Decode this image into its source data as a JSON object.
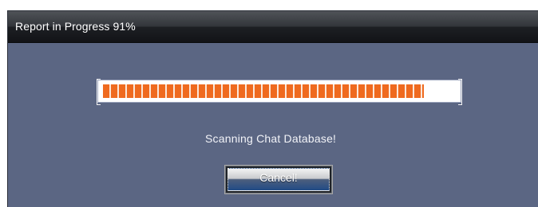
{
  "window": {
    "title": "Report in Progress 91%"
  },
  "progress": {
    "value": 0.91,
    "accent": "#ef6a1f"
  },
  "status": {
    "text": "Scanning Chat Database!"
  },
  "buttons": {
    "cancel_label": "Cancel!"
  },
  "colors": {
    "dialog_background": "#5b6683",
    "titlebar": "#1d1f23",
    "button_blue": "#214b86"
  }
}
